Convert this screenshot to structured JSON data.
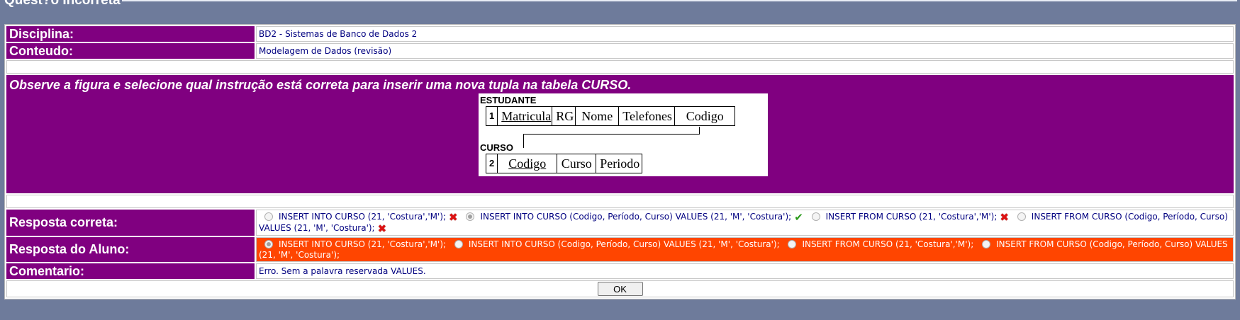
{
  "legend": "Quest?o Incorreta",
  "labels": {
    "disciplina": "Disciplina:",
    "conteudo": "Conteudo:",
    "resposta_correta": "Resposta correta:",
    "resposta_aluno": "Resposta do Aluno:",
    "comentario": "Comentario:"
  },
  "values": {
    "disciplina": "BD2 - Sistemas de Banco de Dados 2",
    "conteudo": "Modelagem de Dados (revisão)",
    "comentario": "Erro. Sem a palavra reservada VALUES."
  },
  "question": "Observe a figura e selecione qual instrução está correta para inserir uma nova tupla na tabela CURSO.",
  "figure": {
    "table1_name": "ESTUDANTE",
    "table1_num": "1",
    "table1_cols": [
      "Matricula",
      "RG",
      "Nome",
      "Telefones",
      "Codigo"
    ],
    "table2_name": "CURSO",
    "table2_num": "2",
    "table2_cols": [
      "Codigo",
      "Curso",
      "Periodo"
    ]
  },
  "correct_options": [
    {
      "text": "INSERT INTO CURSO (21, 'Costura','M');",
      "selected": false,
      "mark": "x-icon"
    },
    {
      "text": "INSERT INTO CURSO (Codigo, Período, Curso) VALUES (21, 'M', 'Costura');",
      "selected": true,
      "mark": "check-icon"
    },
    {
      "text": "INSERT FROM CURSO (21, 'Costura','M');",
      "selected": false,
      "mark": "x-icon"
    },
    {
      "text": "INSERT FROM CURSO (Codigo, Período, Curso) VALUES (21, 'M', 'Costura');",
      "selected": false,
      "mark": "x-icon"
    }
  ],
  "student_options": [
    {
      "text": "INSERT INTO CURSO (21, 'Costura','M');",
      "selected": true
    },
    {
      "text": "INSERT INTO CURSO (Codigo, Período, Curso) VALUES (21, 'M', 'Costura');",
      "selected": false
    },
    {
      "text": "INSERT FROM CURSO (21, 'Costura','M');",
      "selected": false
    },
    {
      "text": "INSERT FROM CURSO (Codigo, Período, Curso) VALUES (21, 'M', 'Costura');",
      "selected": false
    }
  ],
  "ok_label": "OK",
  "colors": {
    "label_bg": "#800080",
    "student_bg": "#ff4500",
    "page_bg": "#6e7b9b"
  }
}
